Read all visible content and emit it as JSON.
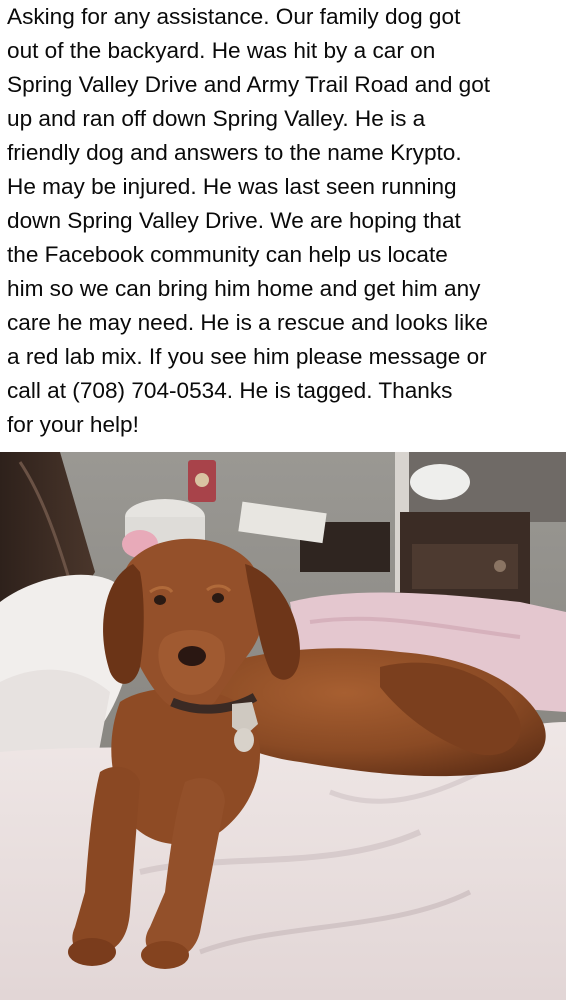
{
  "post": {
    "text_lines": [
      "Asking for any assistance.  Our family dog got",
      "out of the backyard.  He was hit by a car on",
      "Spring Valley Drive and Army Trail Road and got",
      "up and ran off down Spring Valley.  He is a",
      "friendly dog and answers to the name Krypto.",
      "He may be injured.  He was last seen running",
      "down Spring Valley Drive.  We are hoping that",
      "the Facebook community can help us locate",
      "him so we can bring him home and get him any",
      "care he may need.  He is a rescue and looks like",
      "a red lab mix.  If you see him please message or",
      "call at (708) 704-0534.  He is tagged.  Thanks",
      "for your help!"
    ]
  },
  "photo": {
    "subject": "dog-photo",
    "colors": {
      "fur": "#8a4a24",
      "fur_dark": "#5a2c14",
      "fur_light": "#a55d30",
      "bedding": "#ece4e2",
      "bedding_shadow": "#cfc3c4",
      "wall": "#8c8a86",
      "wood": "#3a2a22",
      "blanket_pink": "#e6c9d0",
      "tag": "#c9c4bd"
    }
  }
}
